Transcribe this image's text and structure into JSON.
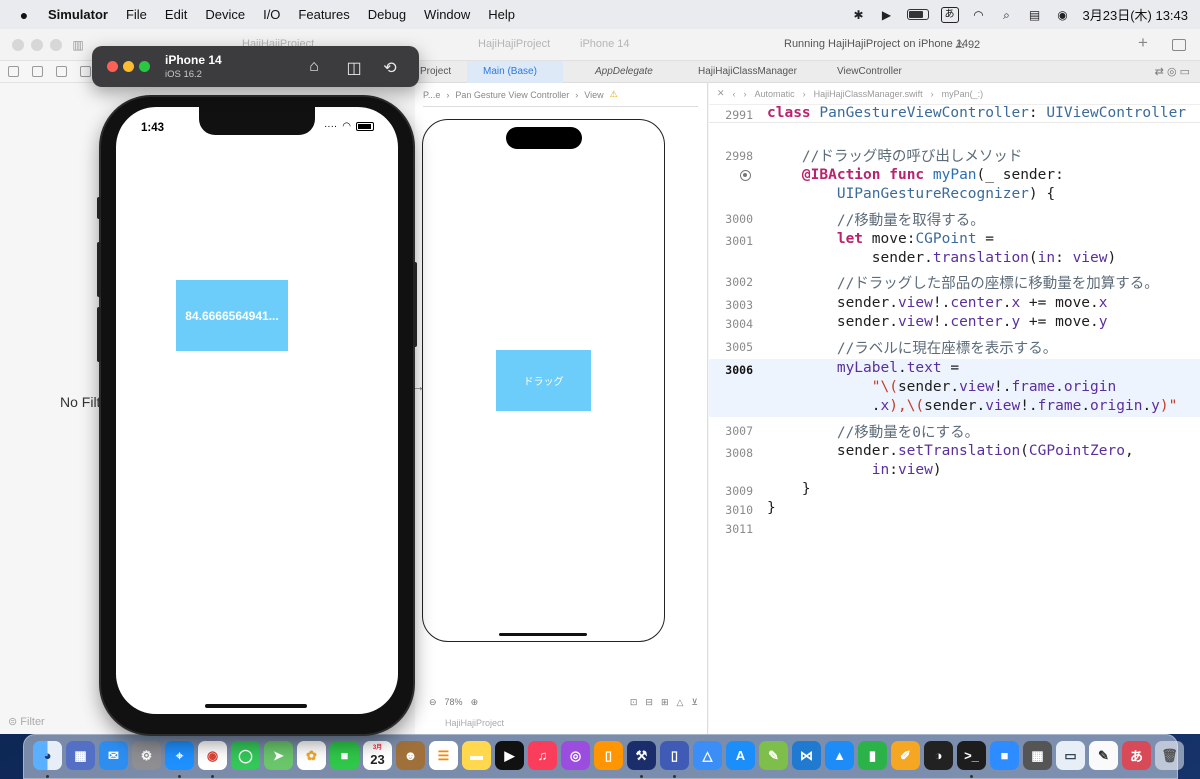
{
  "menubar": {
    "apple": "",
    "items": [
      "Simulator",
      "File",
      "Edit",
      "Device",
      "I/O",
      "Features",
      "Debug",
      "Window",
      "Help"
    ],
    "ime": "あ",
    "clock": "3月23日(木)  13:43"
  },
  "xcode": {
    "project_title": "HajiHajiProject",
    "scheme": "HajiHajiProject",
    "destination": "iPhone 14",
    "status": "Running HajiHajiProject on iPhone 14",
    "warnings": "92",
    "no_filter": "No Filter",
    "filter_placeholder": "Filter",
    "tabs": [
      "Project",
      "Main (Base)",
      "AppDelegate",
      "HajiHajiClassManager",
      "ViewController"
    ],
    "ib_jumpbar": [
      "P...e",
      "Pan Gesture View Controller",
      "View"
    ],
    "ib_button_label": "ドラッグ",
    "zoom": "78%",
    "ib_crumb": "HajiHajiProject",
    "editor_jumpbar": [
      "Automatic",
      "HajiHajiClassManager.swift",
      "myPan(_:)"
    ]
  },
  "code": {
    "sticky_ln": "2991",
    "lines": [
      {
        "ln": "2998",
        "text": "    //ドラッグ時の呼び出しメソッド"
      },
      {
        "ln": "",
        "text": "    @IBAction func myPan(_ sender:"
      },
      {
        "ln": "",
        "text": "        UIPanGestureRecognizer) {"
      },
      {
        "ln": "3000",
        "text": "        //移動量を取得する。"
      },
      {
        "ln": "3001",
        "text": "        let move:CGPoint ="
      },
      {
        "ln": "",
        "text": "            sender.translation(in: view)"
      },
      {
        "ln": "3002",
        "text": "        //ドラッグした部品の座標に移動量を加算する。"
      },
      {
        "ln": "3003",
        "text": "        sender.view!.center.x += move.x"
      },
      {
        "ln": "3004",
        "text": "        sender.view!.center.y += move.y"
      },
      {
        "ln": "3005",
        "text": "        //ラベルに現在座標を表示する。"
      },
      {
        "ln": "3006",
        "text": "        myLabel.text ="
      },
      {
        "ln": "",
        "text": "            \"\\(sender.view!.frame.origin"
      },
      {
        "ln": "",
        "text": "            .x),\\(sender.view!.frame.origin.y)\""
      },
      {
        "ln": "3007",
        "text": "        //移動量を0にする。"
      },
      {
        "ln": "3008",
        "text": "        sender.setTranslation(CGPointZero,"
      },
      {
        "ln": "",
        "text": "            in:view)"
      },
      {
        "ln": "3009",
        "text": "    }"
      },
      {
        "ln": "3010",
        "text": "}"
      },
      {
        "ln": "3011",
        "text": ""
      }
    ],
    "sticky_text": "class PanGestureViewController: UIViewController"
  },
  "simulator": {
    "device": "iPhone 14",
    "os": "iOS 16.2",
    "time": "1:43",
    "label_text": "84.6666564941..."
  },
  "dock": {
    "calendar_month": "3月",
    "calendar_day": "23",
    "ime": "あ"
  },
  "colors": {
    "accent": "#6ccdfb",
    "keyword": "#b8236f"
  }
}
